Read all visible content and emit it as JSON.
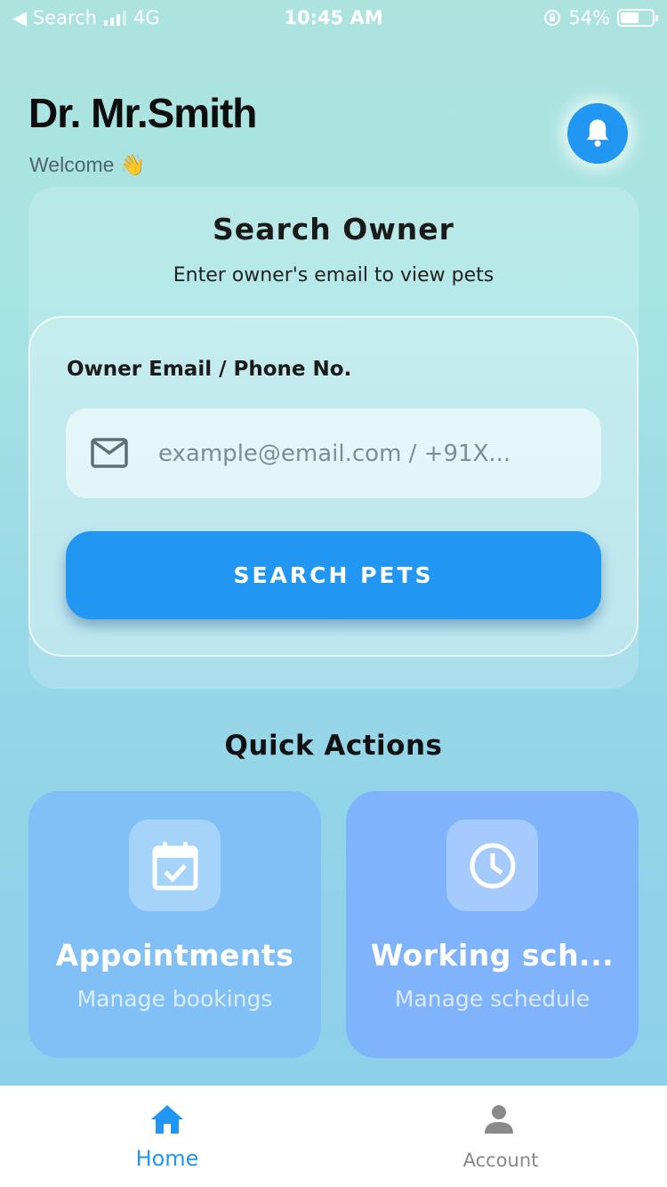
{
  "status_bar": {
    "back_label": "◀ Search",
    "network": "4G",
    "time": "10:45 AM",
    "battery": "54%",
    "battery_level": 0.54
  },
  "header": {
    "doctor_name": "Dr. Mr.Smith",
    "welcome": "Welcome",
    "welcome_emoji": "👋",
    "notification_icon": "bell-icon"
  },
  "search_card": {
    "title": "Search Owner",
    "subtitle": "Enter owner's email to view pets",
    "field_label": "Owner Email / Phone No.",
    "field_icon": "mail-icon",
    "placeholder": "example@email.com / +91X...",
    "value": "",
    "button_label": "SEARCH PETS"
  },
  "quick_actions": {
    "title": "Quick Actions",
    "items": [
      {
        "title": "Appointments",
        "subtitle": "Manage bookings",
        "icon": "calendar-check-icon"
      },
      {
        "title": "Working sch...",
        "subtitle": "Manage schedule",
        "icon": "clock-icon"
      }
    ]
  },
  "bottom_nav": {
    "items": [
      {
        "label": "Home",
        "icon": "home-icon",
        "active": true
      },
      {
        "label": "Account",
        "icon": "person-icon",
        "active": false
      }
    ]
  },
  "colors": {
    "accent": "#2196f3",
    "tile_appointments": "#80c0f7",
    "tile_schedule": "#7fb3fb"
  }
}
